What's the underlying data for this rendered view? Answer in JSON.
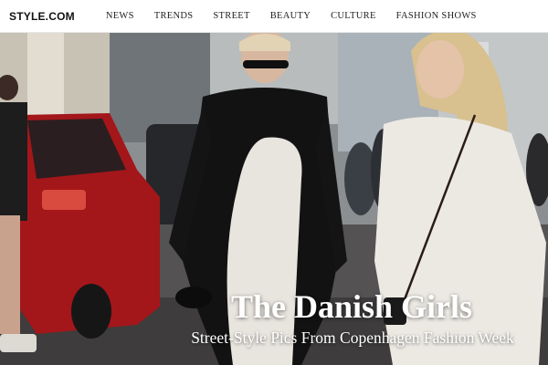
{
  "header": {
    "logo": "STYLE.COM",
    "nav": [
      "NEWS",
      "TRENDS",
      "STREET",
      "BEAUTY",
      "CULTURE",
      "FASHION SHOWS"
    ]
  },
  "hero": {
    "title": "The Danish Girls",
    "subtitle": "Street-Style Pics From Copenhagen Fashion Week",
    "image_alt": "street-style-photo"
  },
  "colors": {
    "text": "#111111",
    "headline": "#ffffff",
    "car_red": "#a3161a"
  }
}
